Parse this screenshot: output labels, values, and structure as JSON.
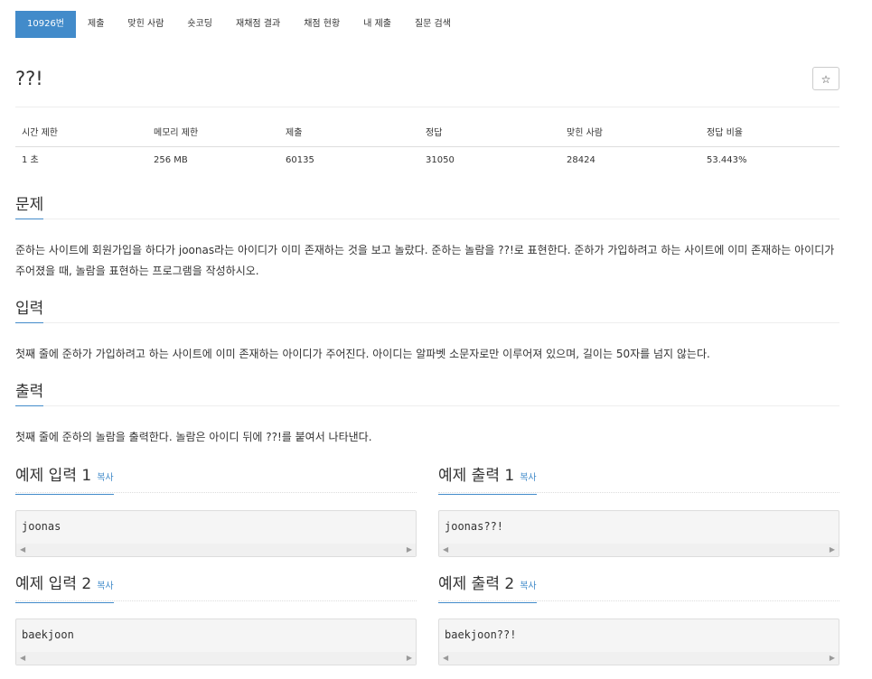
{
  "tabs": [
    {
      "label": "10926번",
      "active": true
    },
    {
      "label": "제출"
    },
    {
      "label": "맞힌 사람"
    },
    {
      "label": "숏코딩"
    },
    {
      "label": "재채점 결과"
    },
    {
      "label": "채점 현황"
    },
    {
      "label": "내 제출"
    },
    {
      "label": "질문 검색"
    }
  ],
  "title": "??!",
  "star_icon": "☆",
  "info": {
    "headers": [
      "시간 제한",
      "메모리 제한",
      "제출",
      "정답",
      "맞힌 사람",
      "정답 비율"
    ],
    "values": [
      "1 초",
      "256 MB",
      "60135",
      "31050",
      "28424",
      "53.443%"
    ]
  },
  "sections": {
    "problem": {
      "title": "문제",
      "text": "준하는 사이트에 회원가입을 하다가 joonas라는 아이디가 이미 존재하는 것을 보고 놀랐다. 준하는 놀람을 ??!로 표현한다. 준하가 가입하려고 하는 사이트에 이미 존재하는 아이디가 주어졌을 때, 놀람을 표현하는 프로그램을 작성하시오."
    },
    "input": {
      "title": "입력",
      "text": "첫째 줄에 준하가 가입하려고 하는 사이트에 이미 존재하는 아이디가 주어진다. 아이디는 알파벳 소문자로만 이루어져 있으며, 길이는 50자를 넘지 않는다."
    },
    "output": {
      "title": "출력",
      "text": "첫째 줄에 준하의 놀람을 출력한다. 놀람은 아이디 뒤에 ??!를 붙여서 나타낸다."
    }
  },
  "copy_label": "복사",
  "examples": [
    {
      "in_title": "예제 입력 1",
      "in_value": "joonas",
      "out_title": "예제 출력 1",
      "out_value": "joonas??!"
    },
    {
      "in_title": "예제 입력 2",
      "in_value": "baekjoon",
      "out_title": "예제 출력 2",
      "out_value": "baekjoon??!"
    }
  ]
}
